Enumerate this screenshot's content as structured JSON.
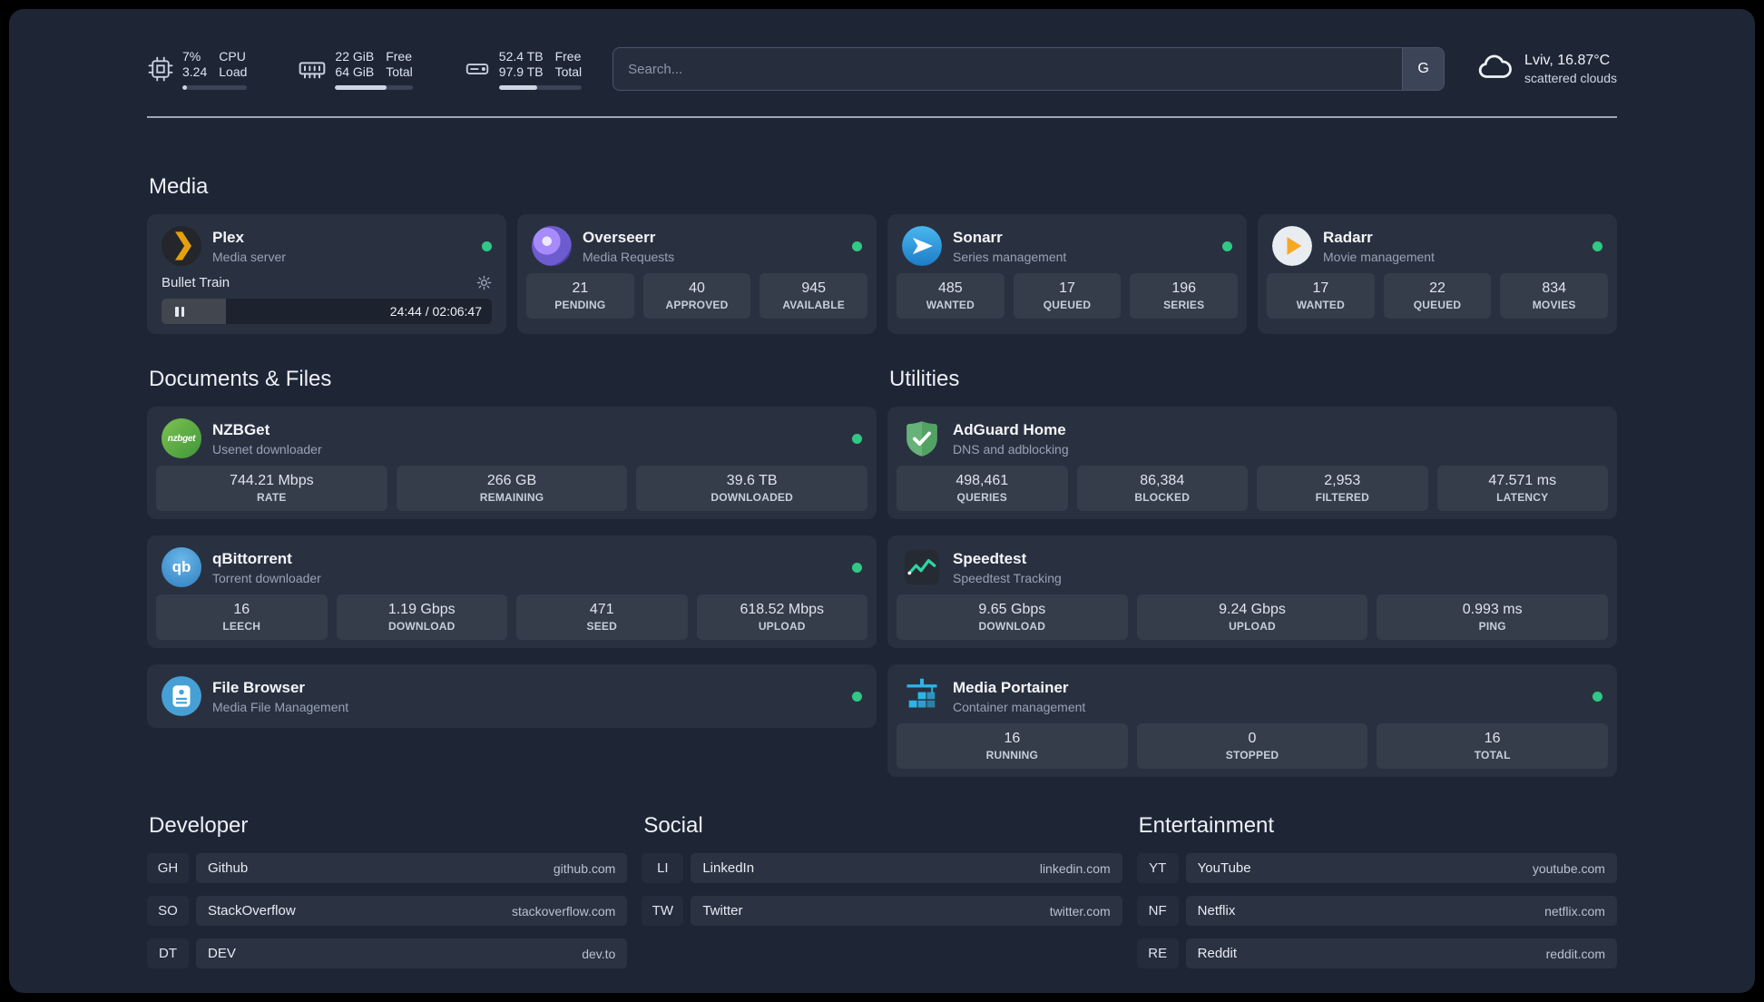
{
  "topbar": {
    "cpu": {
      "value": "7%",
      "sub": "3.24",
      "label": "CPU",
      "sublabel": "Load",
      "percent": 7
    },
    "memory": {
      "value": "22 GiB",
      "sub": "64 GiB",
      "label": "Free",
      "sublabel": "Total",
      "percent": 66
    },
    "disk": {
      "value": "52.4 TB",
      "sub": "97.9 TB",
      "label": "Free",
      "sublabel": "Total",
      "percent": 46
    },
    "search": {
      "placeholder": "Search...",
      "provider": "G"
    },
    "weather": {
      "location": "Lviv, 16.87°C",
      "condition": "scattered clouds"
    }
  },
  "media": {
    "title": "Media",
    "plex": {
      "name": "Plex",
      "desc": "Media server",
      "now_playing": "Bullet Train",
      "time": "24:44 / 02:06:47",
      "progress_percent": 19.5
    },
    "overseerr": {
      "name": "Overseerr",
      "desc": "Media Requests",
      "stats": [
        {
          "value": "21",
          "label": "PENDING"
        },
        {
          "value": "40",
          "label": "APPROVED"
        },
        {
          "value": "945",
          "label": "AVAILABLE"
        }
      ]
    },
    "sonarr": {
      "name": "Sonarr",
      "desc": "Series management",
      "stats": [
        {
          "value": "485",
          "label": "WANTED"
        },
        {
          "value": "17",
          "label": "QUEUED"
        },
        {
          "value": "196",
          "label": "SERIES"
        }
      ]
    },
    "radarr": {
      "name": "Radarr",
      "desc": "Movie management",
      "stats": [
        {
          "value": "17",
          "label": "WANTED"
        },
        {
          "value": "22",
          "label": "QUEUED"
        },
        {
          "value": "834",
          "label": "MOVIES"
        }
      ]
    }
  },
  "documents": {
    "title": "Documents & Files",
    "nzbget": {
      "name": "NZBGet",
      "desc": "Usenet downloader",
      "stats": [
        {
          "value": "744.21 Mbps",
          "label": "RATE"
        },
        {
          "value": "266 GB",
          "label": "REMAINING"
        },
        {
          "value": "39.6 TB",
          "label": "DOWNLOADED"
        }
      ]
    },
    "qbittorrent": {
      "name": "qBittorrent",
      "desc": "Torrent downloader",
      "stats": [
        {
          "value": "16",
          "label": "LEECH"
        },
        {
          "value": "1.19 Gbps",
          "label": "DOWNLOAD"
        },
        {
          "value": "471",
          "label": "SEED"
        },
        {
          "value": "618.52 Mbps",
          "label": "UPLOAD"
        }
      ]
    },
    "filebrowser": {
      "name": "File Browser",
      "desc": "Media File Management"
    }
  },
  "utilities": {
    "title": "Utilities",
    "adguard": {
      "name": "AdGuard Home",
      "desc": "DNS and adblocking",
      "stats": [
        {
          "value": "498,461",
          "label": "QUERIES"
        },
        {
          "value": "86,384",
          "label": "BLOCKED"
        },
        {
          "value": "2,953",
          "label": "FILTERED"
        },
        {
          "value": "47.571 ms",
          "label": "LATENCY"
        }
      ]
    },
    "speedtest": {
      "name": "Speedtest",
      "desc": "Speedtest Tracking",
      "stats": [
        {
          "value": "9.65 Gbps",
          "label": "DOWNLOAD"
        },
        {
          "value": "9.24 Gbps",
          "label": "UPLOAD"
        },
        {
          "value": "0.993 ms",
          "label": "PING"
        }
      ]
    },
    "portainer": {
      "name": "Media Portainer",
      "desc": "Container management",
      "stats": [
        {
          "value": "16",
          "label": "RUNNING"
        },
        {
          "value": "0",
          "label": "STOPPED"
        },
        {
          "value": "16",
          "label": "TOTAL"
        }
      ]
    }
  },
  "bookmarks": {
    "developer": {
      "title": "Developer",
      "items": [
        {
          "abbr": "GH",
          "name": "Github",
          "href": "github.com"
        },
        {
          "abbr": "SO",
          "name": "StackOverflow",
          "href": "stackoverflow.com"
        },
        {
          "abbr": "DT",
          "name": "DEV",
          "href": "dev.to"
        }
      ]
    },
    "social": {
      "title": "Social",
      "items": [
        {
          "abbr": "LI",
          "name": "LinkedIn",
          "href": "linkedin.com"
        },
        {
          "abbr": "TW",
          "name": "Twitter",
          "href": "twitter.com"
        }
      ]
    },
    "entertainment": {
      "title": "Entertainment",
      "items": [
        {
          "abbr": "YT",
          "name": "YouTube",
          "href": "youtube.com"
        },
        {
          "abbr": "NF",
          "name": "Netflix",
          "href": "netflix.com"
        },
        {
          "abbr": "RE",
          "name": "Reddit",
          "href": "reddit.com"
        }
      ]
    }
  },
  "icons": {
    "nzbget_text": "nzbget",
    "qbittorrent_text": "qb"
  },
  "colors": {
    "background": "#1e2636",
    "status_online": "#30c884",
    "plex_amber": "#e5a00d",
    "radarr_amber": "#f7a823",
    "sonarr_blue": "#35a7e8",
    "adguard_green": "#5aa768",
    "portainer_blue": "#2db5e8",
    "speedtest_green": "#2fd3a4"
  }
}
